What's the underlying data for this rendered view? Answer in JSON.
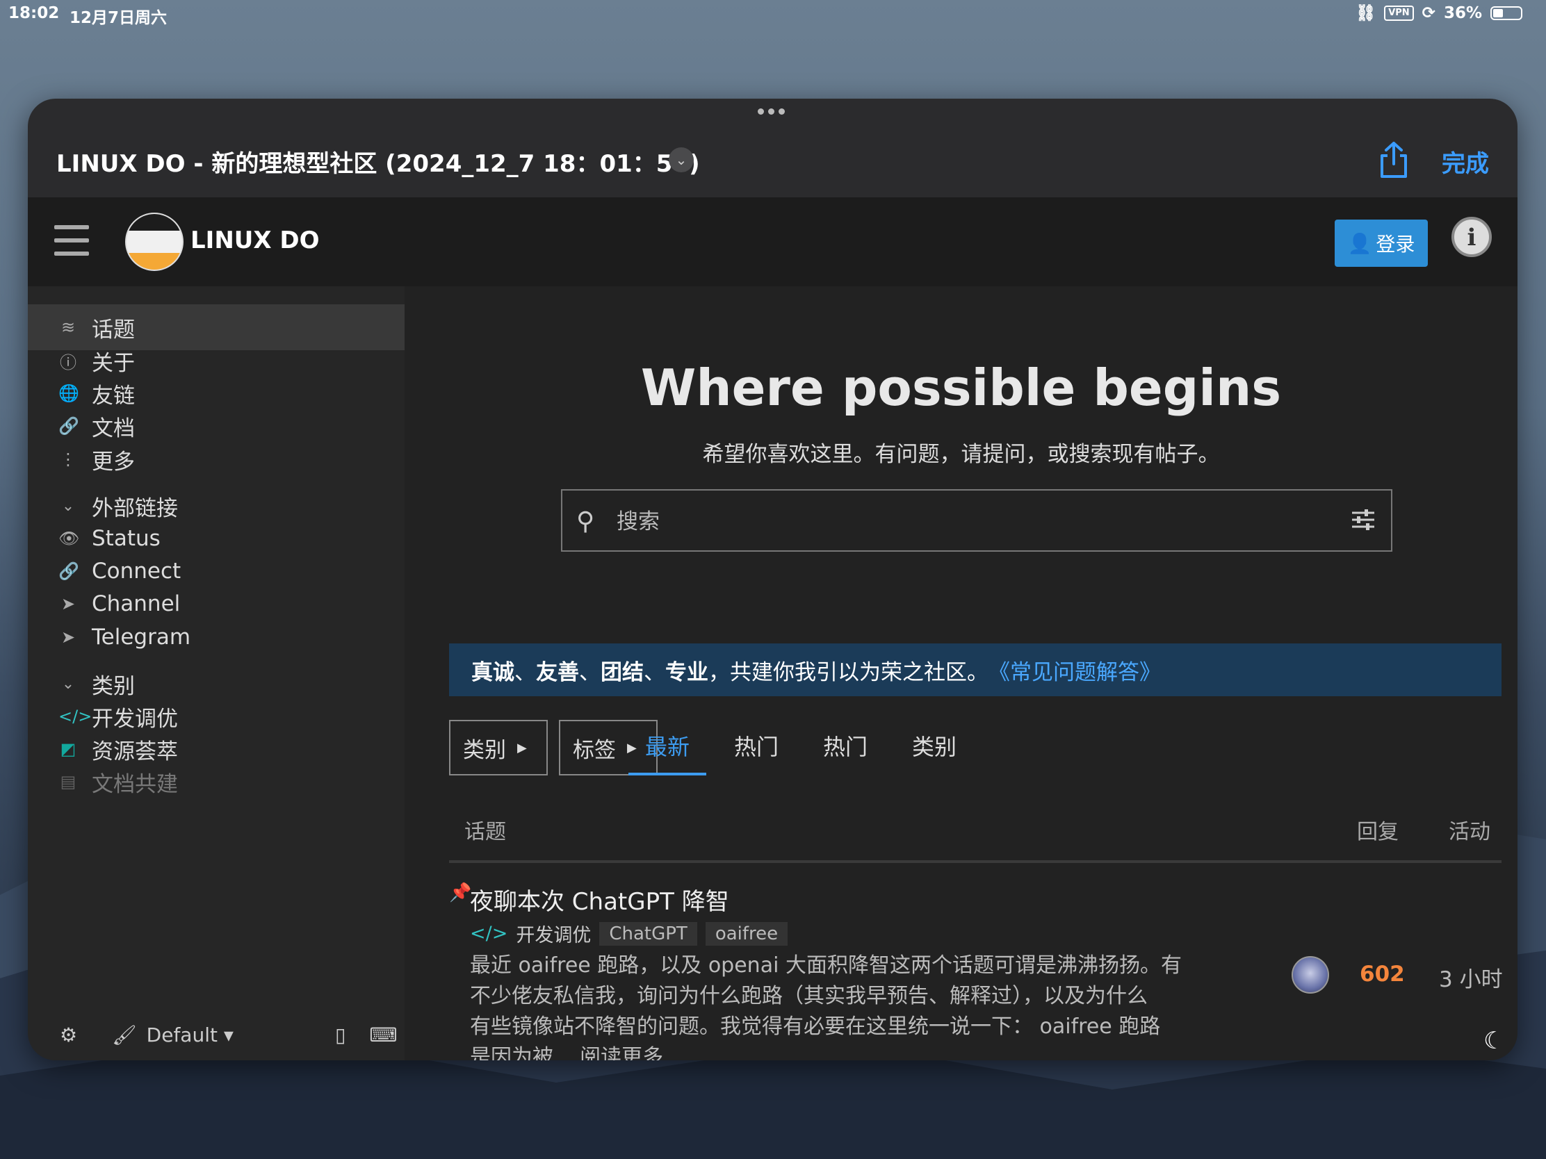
{
  "status_bar": {
    "time": "18:02",
    "date": "12月7日周六",
    "vpn": "VPN",
    "battery": "36%",
    "battery_level": 0.36
  },
  "window": {
    "title": "LINUX DO - 新的理想型社区 (2024_12_7 18：01：54)",
    "done_label": "完成"
  },
  "site_header": {
    "site_name": "LINUX DO",
    "login_label": "登录"
  },
  "sidebar": {
    "items": [
      {
        "label": "话题",
        "icon": "layers-icon"
      },
      {
        "label": "关于",
        "icon": "info-icon"
      },
      {
        "label": "友链",
        "icon": "globe-icon"
      },
      {
        "label": "文档",
        "icon": "link-icon"
      },
      {
        "label": "更多",
        "icon": "more-icon"
      }
    ],
    "external_section": "外部链接",
    "external_links": [
      {
        "label": "Status",
        "icon": "eye-icon"
      },
      {
        "label": "Connect",
        "icon": "link-icon"
      },
      {
        "label": "Channel",
        "icon": "paper-plane-icon"
      },
      {
        "label": "Telegram",
        "icon": "paper-plane-icon"
      }
    ],
    "categories_section": "类别",
    "categories": [
      {
        "label": "开发调优",
        "icon": "code-icon",
        "color": "#32c3c3"
      },
      {
        "label": "资源荟萃",
        "icon": "share-icon",
        "color": "#12a89d"
      },
      {
        "label": "文档共建",
        "icon": "book-icon",
        "color": "#888888"
      }
    ],
    "theme_label": "Default"
  },
  "main": {
    "hero_title": "Where possible begins",
    "hero_subtitle": "希望你喜欢这里。有问题，请提问，或搜索现有帖子。",
    "search_placeholder": "搜索",
    "banner": {
      "parts": [
        "真诚",
        "、",
        "友善",
        "、",
        "团结",
        "、",
        "专业",
        "，共建你我引以为荣之社区。"
      ],
      "link": "《常见问题解答》"
    },
    "filter_category": "类别",
    "filter_tags": "标签",
    "tabs": [
      "最新",
      "热门",
      "热门",
      "类别"
    ],
    "columns": {
      "topic": "话题",
      "replies": "回复",
      "activity": "活动"
    },
    "topics": [
      {
        "title": "夜聊本次 ChatGPT 降智",
        "category": "开发调优",
        "tags": [
          "ChatGPT",
          "oaifree"
        ],
        "excerpt_lines": [
          "最近 oaifree 跑路，以及 openai 大面积降智这两个话题可谓是沸沸扬扬。有",
          "不少佬友私信我，询问为什么跑路（其实我早预告、解释过），以及为什么",
          "有些镜像站不降智的问题。我觉得有必要在这里统一说一下： oaifree 跑路",
          "是因为被... 阅读更多"
        ],
        "replies": "602",
        "activity": "3 小时"
      }
    ]
  },
  "colors": {
    "accent": "#3d9cf0",
    "login_button": "#2d8ed6",
    "banner_bg": "#1b3b58",
    "replies_hot": "#f4853c"
  }
}
